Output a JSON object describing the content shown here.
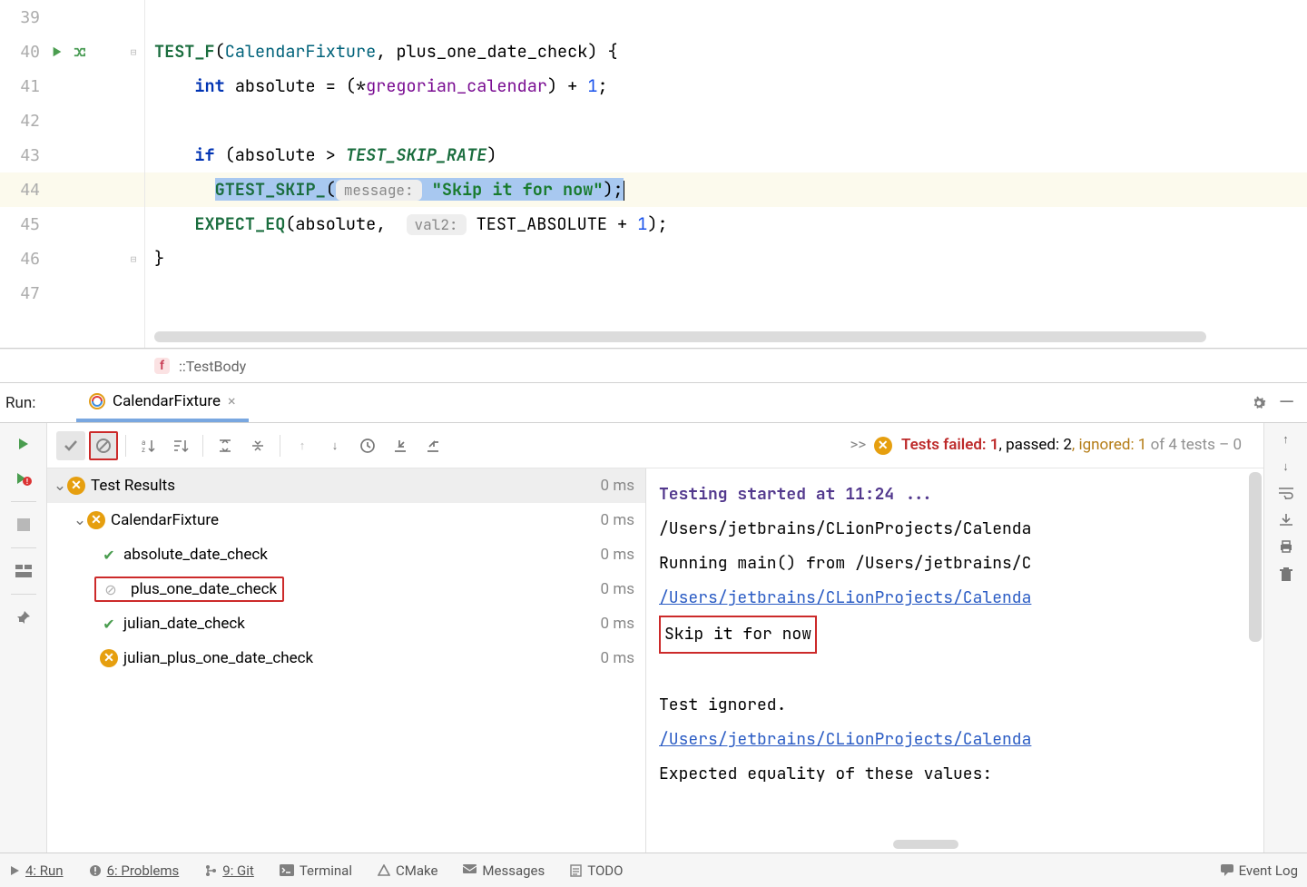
{
  "editor": {
    "lines": [
      {
        "num": "39"
      },
      {
        "num": "40"
      },
      {
        "num": "41"
      },
      {
        "num": "42"
      },
      {
        "num": "43"
      },
      {
        "num": "44"
      },
      {
        "num": "45"
      },
      {
        "num": "46"
      },
      {
        "num": "47"
      }
    ],
    "code": {
      "l40": {
        "test_f": "TEST_F",
        "fixture": "CalendarFixture",
        "comma": ", ",
        "name": "plus_one_date_check",
        "brace": ") {"
      },
      "l41": {
        "kw": "int",
        "var": " absolute = (*",
        "id": "gregorian_calendar",
        "rest": ") + ",
        "one": "1",
        "semi": ";"
      },
      "l43": {
        "if": "if",
        "open": " (absolute > ",
        "macro": "TEST_SKIP_RATE",
        "close": ")"
      },
      "l44": {
        "skip": "GTEST_SKIP_",
        "open": "(",
        "hint": "message:",
        "str": " \"Skip it for now\"",
        "close": ");"
      },
      "l45": {
        "eq": "EXPECT_EQ",
        "open": "(absolute,  ",
        "hint": "val2:",
        "mid": " TEST_ABSOLUTE + ",
        "one": "1",
        "close": ");"
      },
      "l46": {
        "brace": "}"
      }
    }
  },
  "crumb": {
    "label": "::TestBody"
  },
  "run_tab": {
    "label": "Run:",
    "name": "CalendarFixture"
  },
  "test_summary": {
    "chevrons": ">>",
    "fail_prefix": "Tests failed: ",
    "fail_n": "1",
    "pass_prefix": ", passed: ",
    "pass_n": "2",
    "ignored_prefix": ", ignored: ",
    "ignored_n": "1",
    "tail": " of 4 tests – 0"
  },
  "tree": {
    "root": {
      "label": "Test Results",
      "time": "0 ms"
    },
    "fixture": {
      "label": "CalendarFixture",
      "time": "0 ms"
    },
    "tests": [
      {
        "label": "absolute_date_check",
        "time": "0 ms",
        "status": "pass"
      },
      {
        "label": "plus_one_date_check",
        "time": "0 ms",
        "status": "skip",
        "highlight": true
      },
      {
        "label": "julian_date_check",
        "time": "0 ms",
        "status": "pass"
      },
      {
        "label": "julian_plus_one_date_check",
        "time": "0 ms",
        "status": "fail"
      }
    ]
  },
  "console": {
    "l1a": "Testing started at ",
    "l1b": "11:24",
    "l1c": " ...",
    "l2": "/Users/jetbrains/CLionProjects/Calenda",
    "l3": "Running main() from /Users/jetbrains/C",
    "l4": "/Users/jetbrains/CLionProjects/Calenda",
    "l5": "Skip it for now",
    "l7": "Test ignored.",
    "l8": "/Users/jetbrains/CLionProjects/Calenda",
    "l9": "Expected equality of these values:"
  },
  "status": {
    "run": "4: Run",
    "problems": "6: Problems",
    "git": "9: Git",
    "terminal": "Terminal",
    "cmake": "CMake",
    "messages": "Messages",
    "todo": "TODO",
    "eventlog": "Event Log"
  }
}
